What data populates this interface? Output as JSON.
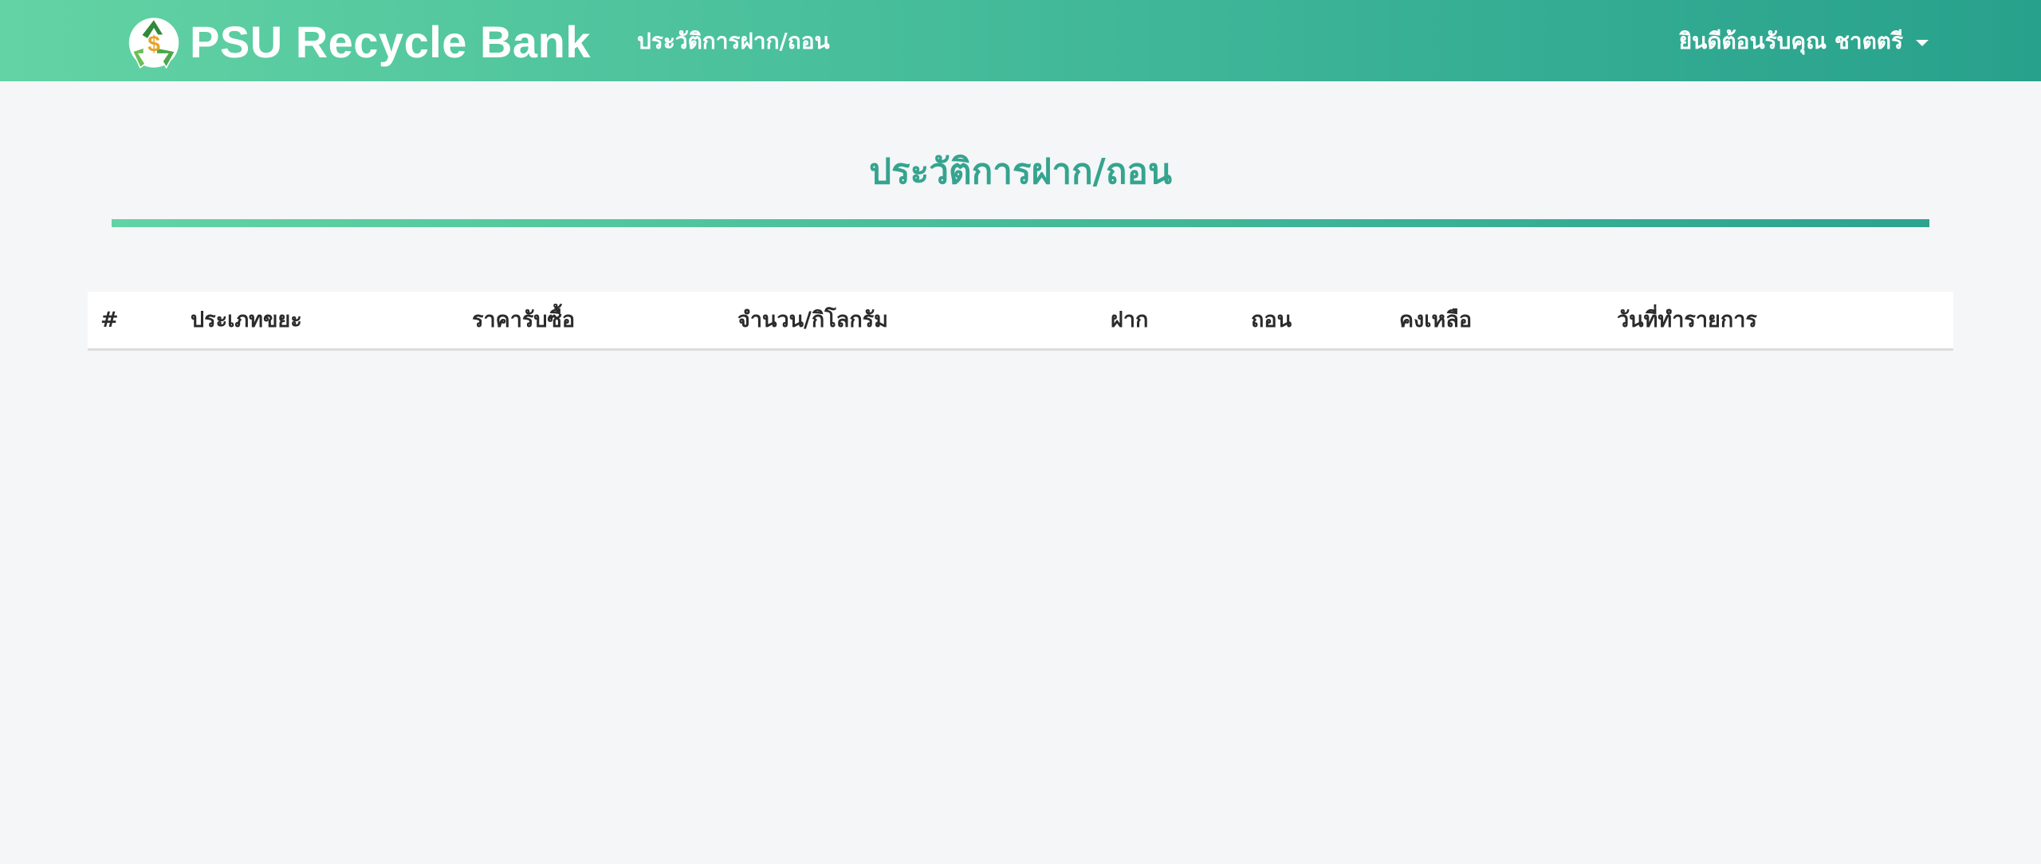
{
  "navbar": {
    "brand_name": "PSU Recycle Bank",
    "logo_icon": "recycle-dollar-logo",
    "nav_link": "ประวัติการฝาก/ถอน",
    "user_greeting": "ยินดีต้อนรับคุณ ชาตตรี",
    "user_menu_icon": "caret-down-icon"
  },
  "page": {
    "title": "ประวัติการฝาก/ถอน"
  },
  "table": {
    "columns": [
      "#",
      "ประเภทขยะ",
      "ราคารับซื้อ",
      "จำนวน/กิโลกรัม",
      "ฝาก",
      "ถอน",
      "คงเหลือ",
      "วันที่ทำรายการ"
    ],
    "rows": []
  },
  "colors": {
    "nav_gradient_start": "#63d3a4",
    "nav_gradient_end": "#28a18c",
    "title_color": "#35a48f",
    "page_background": "#f4f6f8"
  }
}
